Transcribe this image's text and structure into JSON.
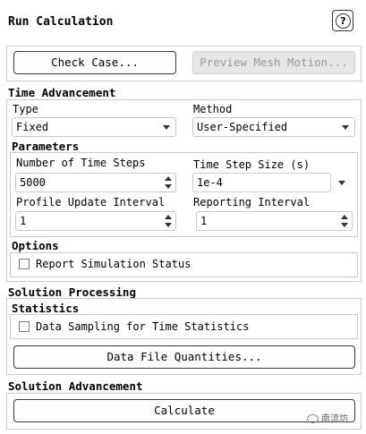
{
  "title": "Run Calculation",
  "help_icon_glyph": "?",
  "buttons": {
    "check_case": "Check Case...",
    "preview_mesh": "Preview Mesh Motion...",
    "data_file_quantities": "Data File Quantities...",
    "calculate": "Calculate"
  },
  "time_advancement": {
    "title": "Time Advancement",
    "type_label": "Type",
    "type_value": "Fixed",
    "method_label": "Method",
    "method_value": "User-Specified"
  },
  "parameters": {
    "title": "Parameters",
    "num_steps_label": "Number of Time Steps",
    "num_steps_value": "5000",
    "step_size_label": "Time Step Size (s)",
    "step_size_value": "1e-4",
    "profile_label": "Profile Update Interval",
    "profile_value": "1",
    "reporting_label": "Reporting Interval",
    "reporting_value": "1"
  },
  "options": {
    "title": "Options",
    "report_status_label": "Report Simulation Status",
    "report_status_checked": false
  },
  "solution_processing": {
    "title": "Solution Processing",
    "statistics_title": "Statistics",
    "data_sampling_label": "Data Sampling for Time Statistics",
    "data_sampling_checked": false
  },
  "solution_advancement": {
    "title": "Solution Advancement"
  },
  "watermark": "南流坊"
}
